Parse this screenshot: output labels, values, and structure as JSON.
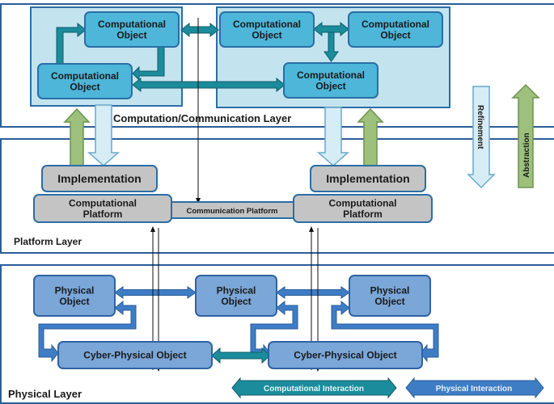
{
  "layers": {
    "computation": "Computation/Communication Layer",
    "platform": "Platform Layer",
    "physical": "Physical Layer"
  },
  "computational_object": [
    "Computational",
    "Object"
  ],
  "implementation": "Implementation",
  "computational_platform": [
    "Computational",
    "Platform"
  ],
  "communication_platform": "Communication Platform",
  "physical_object": [
    "Physical",
    "Object"
  ],
  "cyber_physical_object": "Cyber-Physical Object",
  "side_arrows": {
    "refinement": "Refinement",
    "abstraction": "Abstraction"
  },
  "legend": {
    "computational": "Computational Interaction",
    "physical": "Physical Interaction"
  },
  "colors": {
    "computational_interaction": "#1b8c9c",
    "physical_interaction": "#3e7dc6",
    "abstraction": "#9dc07c",
    "refinement": "#d6edf6"
  }
}
